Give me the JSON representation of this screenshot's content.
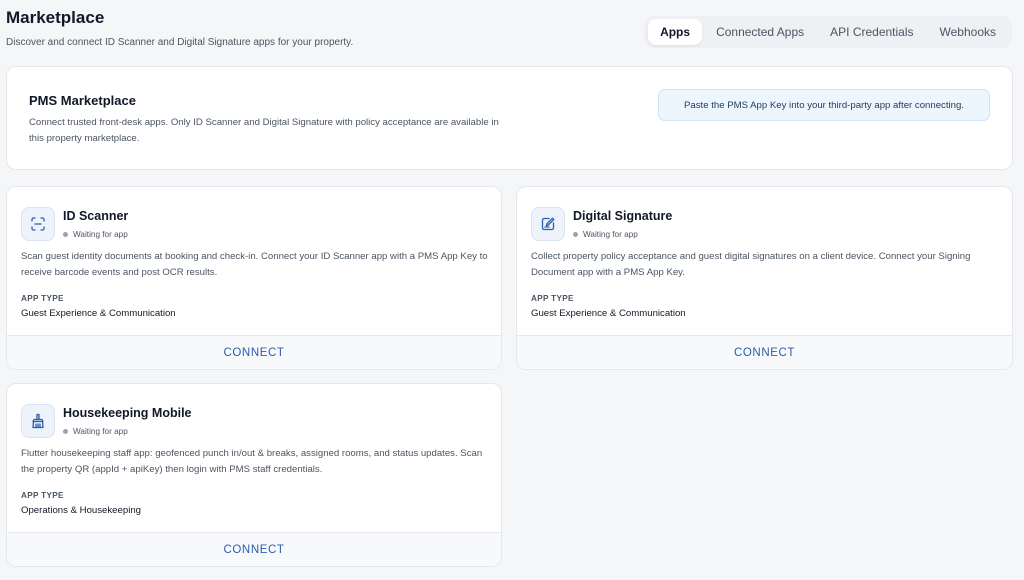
{
  "header": {
    "title": "Marketplace",
    "subtitle": "Discover and connect ID Scanner and Digital Signature apps for your property."
  },
  "tabs": [
    {
      "label": "Apps",
      "active": true
    },
    {
      "label": "Connected Apps",
      "active": false
    },
    {
      "label": "API Credentials",
      "active": false
    },
    {
      "label": "Webhooks",
      "active": false
    }
  ],
  "intro": {
    "title": "PMS Marketplace",
    "description": "Connect trusted front-desk apps. Only ID Scanner and Digital Signature with policy acceptance are available in this property marketplace.",
    "hint": "Paste the PMS App Key into your third-party app after connecting."
  },
  "apps": [
    {
      "name": "ID Scanner",
      "icon": "scan-icon",
      "status": "Waiting for app",
      "description": "Scan guest identity documents at booking and check-in. Connect your ID Scanner app with a PMS App Key to receive barcode events and post OCR results.",
      "type_label": "APP TYPE",
      "type_value": "Guest Experience & Communication",
      "action": "CONNECT"
    },
    {
      "name": "Digital Signature",
      "icon": "signature-icon",
      "status": "Waiting for app",
      "description": "Collect property policy acceptance and guest digital signatures on a client device. Connect your Signing Document app with a PMS App Key.",
      "type_label": "APP TYPE",
      "type_value": "Guest Experience & Communication",
      "action": "CONNECT"
    },
    {
      "name": "Housekeeping Mobile",
      "icon": "broom-icon",
      "status": "Waiting for app",
      "description": "Flutter housekeeping staff app: geofenced punch in/out & breaks, assigned rooms, and status updates. Scan the property QR (appId + apiKey) then login with PMS staff credentials.",
      "type_label": "APP TYPE",
      "type_value": "Operations & Housekeeping",
      "action": "CONNECT"
    }
  ],
  "colors": {
    "accent": "#2a5db0",
    "background": "#f5f6f8",
    "hint_background": "#eef6fd"
  }
}
